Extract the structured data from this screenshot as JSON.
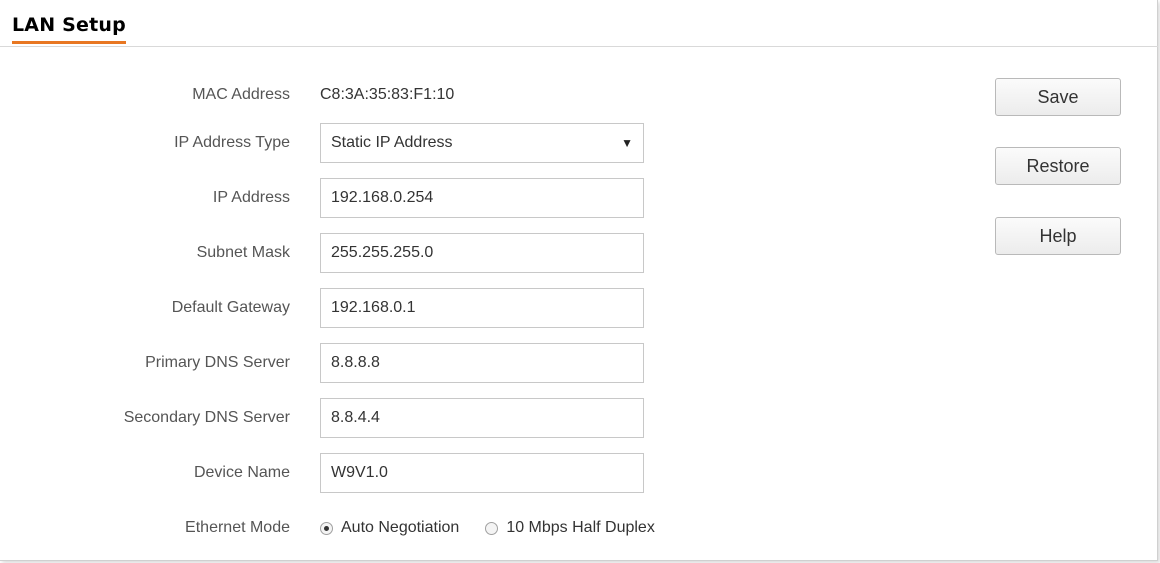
{
  "header": {
    "title": "LAN Setup",
    "accent_color": "#e87722"
  },
  "form": {
    "mac_address": {
      "label": "MAC Address",
      "value": "C8:3A:35:83:F1:10"
    },
    "ip_address_type": {
      "label": "IP Address Type",
      "selected": "Static IP Address",
      "arrow": "▼"
    },
    "ip_address": {
      "label": "IP Address",
      "value": "192.168.0.254"
    },
    "subnet_mask": {
      "label": "Subnet Mask",
      "value": "255.255.255.0"
    },
    "default_gateway": {
      "label": "Default Gateway",
      "value": "192.168.0.1"
    },
    "primary_dns": {
      "label": "Primary DNS Server",
      "value": "8.8.8.8"
    },
    "secondary_dns": {
      "label": "Secondary DNS Server",
      "value": "8.8.4.4"
    },
    "device_name": {
      "label": "Device Name",
      "value": "W9V1.0"
    },
    "ethernet_mode": {
      "label": "Ethernet Mode",
      "options": [
        {
          "label": "Auto Negotiation",
          "checked": true
        },
        {
          "label": "10 Mbps Half Duplex",
          "checked": false
        }
      ]
    }
  },
  "actions": {
    "save_label": "Save",
    "restore_label": "Restore",
    "help_label": "Help"
  }
}
